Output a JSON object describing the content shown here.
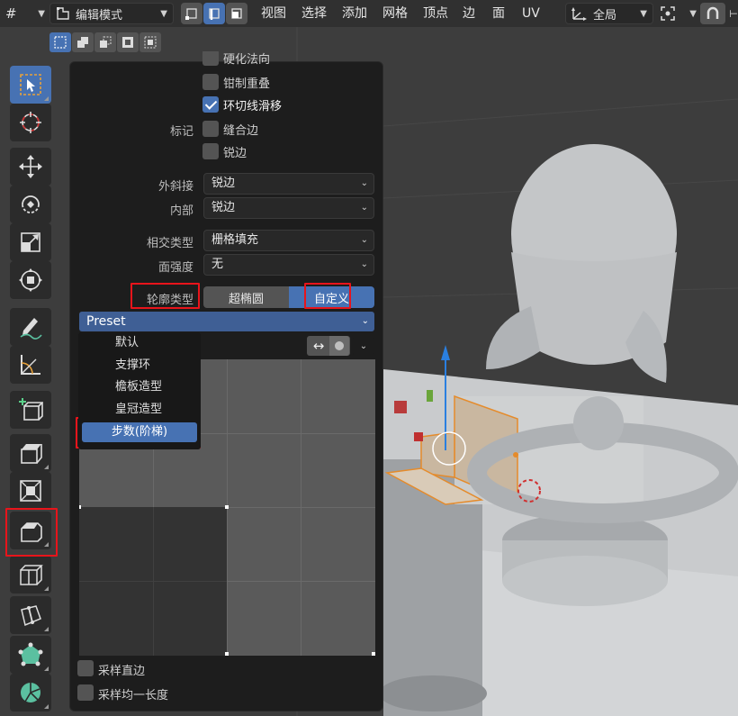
{
  "header": {
    "mode_dropdown": "编辑模式",
    "menus": [
      "视图",
      "选择",
      "添加",
      "网格",
      "顶点",
      "边",
      "面",
      "UV"
    ],
    "orientation_dropdown": "全局"
  },
  "toolbar": {
    "tools": [
      {
        "name": "select-box-tool",
        "icon": "select-box-icon",
        "active": true
      },
      {
        "name": "cursor-tool",
        "icon": "cursor-icon",
        "active": false
      },
      {
        "name": "move-tool",
        "icon": "move-icon",
        "active": false
      },
      {
        "name": "rotate-tool",
        "icon": "rotate-icon",
        "active": false
      },
      {
        "name": "scale-tool",
        "icon": "scale-icon",
        "active": false
      },
      {
        "name": "transform-tool",
        "icon": "transform-icon",
        "active": false
      },
      {
        "name": "annotate-tool",
        "icon": "annotate-icon",
        "active": false
      },
      {
        "name": "measure-tool",
        "icon": "measure-icon",
        "active": false
      },
      {
        "name": "add-cube-tool",
        "icon": "add-cube-icon",
        "active": false
      },
      {
        "name": "extrude-tool",
        "icon": "extrude-icon",
        "active": false
      },
      {
        "name": "inset-tool",
        "icon": "inset-icon",
        "active": false
      },
      {
        "name": "bevel-tool",
        "icon": "bevel-icon",
        "active": false
      },
      {
        "name": "loop-cut-tool",
        "icon": "loop-cut-icon",
        "active": false
      },
      {
        "name": "knife-tool",
        "icon": "knife-icon",
        "active": false
      },
      {
        "name": "poly-build-tool",
        "icon": "poly-build-icon",
        "active": false
      },
      {
        "name": "spin-tool",
        "icon": "spin-icon",
        "active": false
      }
    ]
  },
  "panel": {
    "partial_top_label": "硬化法向",
    "clamp_overlap": {
      "label": "钳制重叠",
      "checked": false
    },
    "loop_slide": {
      "label": "环切线滑移",
      "checked": true
    },
    "mark_label": "标记",
    "mark_seams": {
      "label": "缝合边",
      "checked": false
    },
    "mark_sharp": {
      "label": "锐边",
      "checked": false
    },
    "miter_outer": {
      "label": "外斜接",
      "value": "锐边"
    },
    "miter_inner": {
      "label": "内部",
      "value": "锐边"
    },
    "intersection_type": {
      "label": "相交类型",
      "value": "栅格填充"
    },
    "face_strength": {
      "label": "面强度",
      "value": "无"
    },
    "profile_type": {
      "label": "轮廓类型",
      "options": [
        "超椭圆",
        "自定义"
      ],
      "selected": "自定义"
    },
    "preset": {
      "label": "Preset",
      "items": [
        "默认",
        "支撑环",
        "檐板造型",
        "皇冠造型",
        "步数(阶梯)"
      ],
      "selected": "步数(阶梯)"
    },
    "sample_straight_edges": {
      "label": "采样直边",
      "checked": false
    },
    "sample_even_lengths": {
      "label": "采样均一长度",
      "checked": false
    }
  }
}
